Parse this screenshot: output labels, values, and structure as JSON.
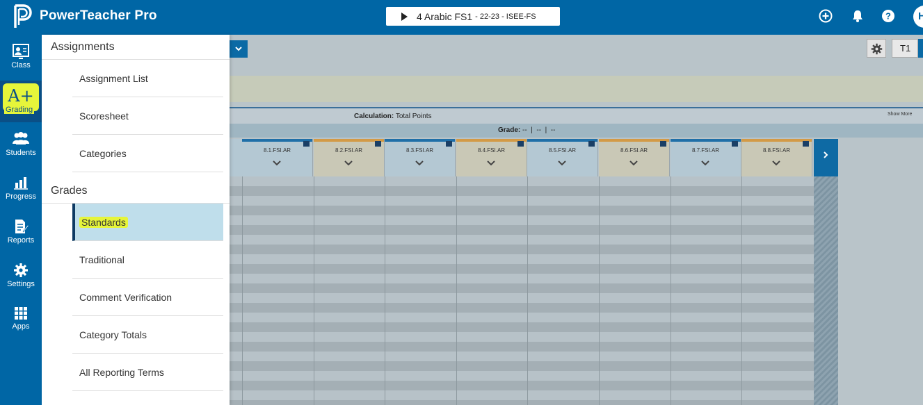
{
  "app": {
    "title": "PowerTeacher Pro",
    "avatar_initial": "H"
  },
  "class_selector": {
    "name": "4 Arabic FS1",
    "term": "- 22-23 - ISEE-FS"
  },
  "left_nav": {
    "items": [
      {
        "label": "Class",
        "icon": "class-icon"
      },
      {
        "label": "Grading",
        "icon": "grading-icon",
        "glyph": "A+"
      },
      {
        "label": "Students",
        "icon": "students-icon"
      },
      {
        "label": "Progress",
        "icon": "progress-icon"
      },
      {
        "label": "Reports",
        "icon": "reports-icon"
      },
      {
        "label": "Settings",
        "icon": "settings-icon"
      },
      {
        "label": "Apps",
        "icon": "apps-icon"
      }
    ]
  },
  "menu": {
    "assignments_header": "Assignments",
    "assignments": [
      "Assignment List",
      "Scoresheet",
      "Categories"
    ],
    "grades_header": "Grades",
    "grades": [
      "Standards",
      "Traditional",
      "Comment Verification",
      "Category Totals",
      "All Reporting Terms"
    ],
    "selected": "Standards"
  },
  "toolbar": {
    "term_label": "T1"
  },
  "calculation": {
    "label": "Calculation:",
    "value": "Total Points",
    "show_more": "Show More"
  },
  "grade_summary": {
    "label": "Grade:",
    "value": "--",
    "v2": "--",
    "v3": "--"
  },
  "standards_columns": [
    "8.1.FSI.AR",
    "8.2.FSI.AR",
    "8.3.FSI.AR",
    "8.4.FSI.AR",
    "8.5.FSI.AR",
    "8.6.FSI.AR",
    "8.7.FSI.AR",
    "8.8.FSI.AR"
  ],
  "colors": {
    "primary": "#0066a5",
    "highlight": "#e6f53a",
    "selected_bg": "#bfdeeb"
  }
}
